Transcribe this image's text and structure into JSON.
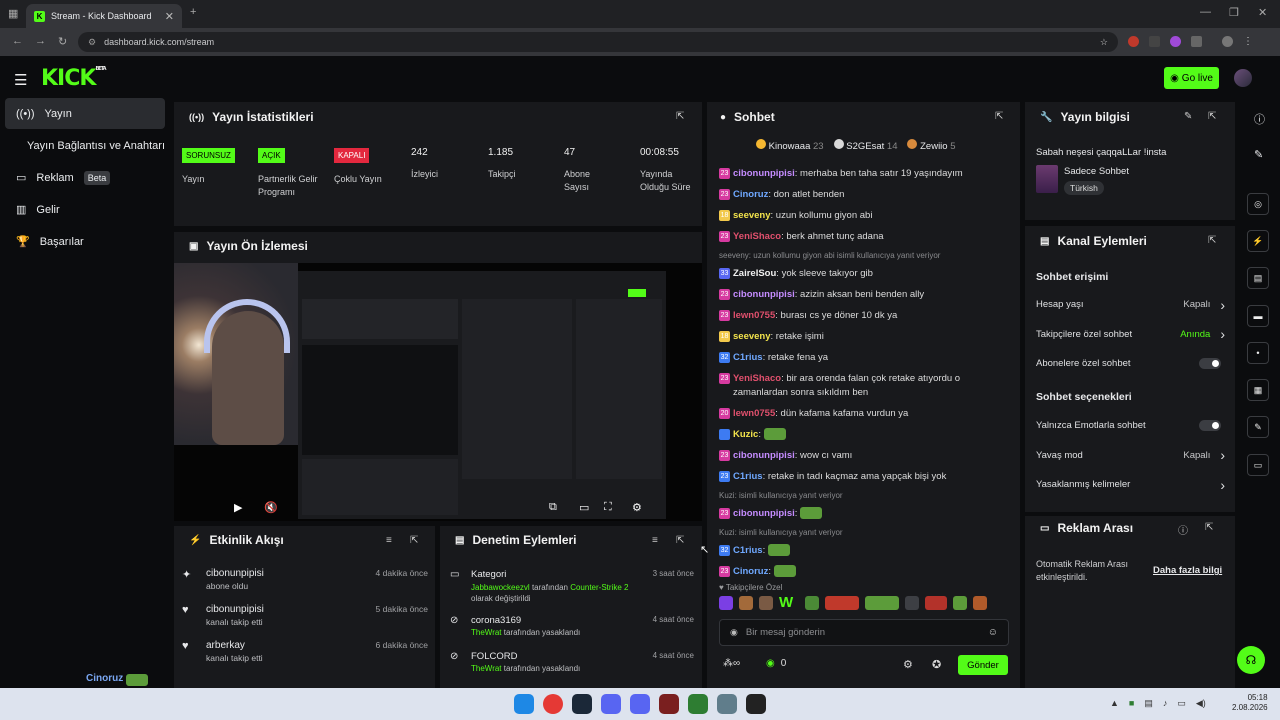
{
  "browser": {
    "tab_title": "Stream - Kick Dashboard",
    "url": "dashboard.kick.com/stream",
    "new_tab": "+"
  },
  "app": {
    "logo": "KICK",
    "logo_badge": "BETA",
    "go_live": "Go live",
    "accent": "#53fc18"
  },
  "nav": [
    {
      "label": "Yayın",
      "icon": "broadcast-icon"
    },
    {
      "label": "Yayın Bağlantısı ve Anahtarı"
    },
    {
      "label": "Reklam",
      "badge": "Beta",
      "icon": "ads-icon"
    },
    {
      "label": "Gelir",
      "icon": "chart-icon"
    },
    {
      "label": "Başarılar",
      "icon": "trophy-icon"
    }
  ],
  "stats": {
    "title": "Yayın İstatistikleri",
    "items": [
      {
        "badge": "SORUNSUZ",
        "label": "Yayın",
        "color": "#53fc18"
      },
      {
        "badge": "AÇIK",
        "label": "Partnerlik Gelir Programı",
        "color": "#53fc18"
      },
      {
        "badge": "KAPALI",
        "label": "Çoklu Yayın",
        "color": "#e3283e"
      },
      {
        "value": "242",
        "label": "İzleyici"
      },
      {
        "value": "1.185",
        "label": "Takipçi"
      },
      {
        "value": "47",
        "label": "Abone Sayısı"
      },
      {
        "value": "00:08:55",
        "label": "Yayında Olduğu Süre"
      }
    ]
  },
  "preview": {
    "title": "Yayın Ön İzlemesi"
  },
  "activity": {
    "title": "Etkinlik Akışı",
    "items": [
      {
        "user": "cibonunpipisi",
        "action": "abone oldu",
        "time": "4 dakika önce",
        "icon": "sparkle-icon"
      },
      {
        "user": "cibonunpipisi",
        "action": "kanalı takip etti",
        "time": "5 dakika önce",
        "icon": "heart-icon"
      },
      {
        "user": "arberkay",
        "action": "kanalı takip etti",
        "time": "6 dakika önce",
        "icon": "heart-icon"
      }
    ]
  },
  "moderation": {
    "title": "Denetim Eylemleri",
    "items": [
      {
        "title": "Kategori",
        "actor": "Jabbawockeezvl",
        "mid": "tarafından",
        "target": "Counter-Strike 2",
        "tail": "olarak değiştirildi",
        "time": "3 saat önce"
      },
      {
        "title": "corona3169",
        "actor": "TheWrat",
        "mid": "tarafından yasaklandı",
        "time": "4 saat önce"
      },
      {
        "title": "FOLCORD",
        "actor": "TheWrat",
        "mid": "tarafından yasaklandı",
        "time": "4 saat önce"
      }
    ]
  },
  "chat": {
    "title": "Sohbet",
    "top": [
      {
        "name": "Kinowaaa",
        "count": "23",
        "color": "#f5b731"
      },
      {
        "name": "S2GEsat",
        "count": "14",
        "color": "#d9d9d9"
      },
      {
        "name": "Zewiio",
        "count": "5",
        "color": "#d88a3c"
      }
    ],
    "messages": [
      {
        "badge": "23",
        "bc": "#d63aa0",
        "user": "cibonunpipisi",
        "uc": "#c58cff",
        "text": "merhaba ben taha satır 19 yaşındayım"
      },
      {
        "badge": "23",
        "bc": "#d63aa0",
        "user": "Cinoruz",
        "uc": "#6fa8ff",
        "text": "don atlet benden"
      },
      {
        "badge": "18",
        "bc": "#f2c94c",
        "user": "seeveny",
        "uc": "#f2e34c",
        "text": "uzun kollumu giyon abi"
      },
      {
        "badge": "23",
        "bc": "#d63aa0",
        "user": "YeniShaco",
        "uc": "#e0506d",
        "text": "berk ahmet tunç adana"
      },
      {
        "reply": "seeveny: uzun kollumu giyon abi isimli kullanıcıya yanıt veriyor"
      },
      {
        "badge": "33",
        "bc": "#5867f2",
        "user": "ZaireISou",
        "uc": "#f0f0f0",
        "text": "yok sleeve takıyor gib"
      },
      {
        "badge": "23",
        "bc": "#d63aa0",
        "user": "cibonunpipisi",
        "uc": "#c58cff",
        "text": "azizin aksan beni benden ally"
      },
      {
        "badge": "23",
        "bc": "#d63aa0",
        "user": "lewn0755",
        "uc": "#e0506d",
        "text": "burası cs ye döner 10 dk ya"
      },
      {
        "badge": "18",
        "bc": "#f2c94c",
        "user": "seeveny",
        "uc": "#f2e34c",
        "text": "retake işimi"
      },
      {
        "badge": "32",
        "bc": "#3d7bf2",
        "user": "C1rius",
        "uc": "#6fa8ff",
        "text": "retake fena ya"
      },
      {
        "badge": "23",
        "bc": "#d63aa0",
        "user": "YeniShaco",
        "uc": "#e0506d",
        "text": "bir ara orenda falan çok retake atıyordu o zamanlardan sonra sıkıldım ben"
      },
      {
        "badge": "20",
        "bc": "#d63aa0",
        "user": "lewn0755",
        "uc": "#e0506d",
        "text": "dün kafama kafama vurdun ya"
      },
      {
        "badge": "",
        "bc": "#3d7bf2",
        "user": "Kuzic",
        "uc": "#f2e34c",
        "text": ""
      },
      {
        "badge": "23",
        "bc": "#d63aa0",
        "user": "cibonunpipisi",
        "uc": "#c58cff",
        "text": "wow cı vamı"
      },
      {
        "badge": "23",
        "bc": "#3d7bf2",
        "user": "C1rius",
        "uc": "#6fa8ff",
        "text": "retake in tadı kaçmaz ama yapçak bişi yok"
      },
      {
        "reply": "Kuzi: isimli kullanıcıya yanıt veriyor"
      },
      {
        "badge": "23",
        "bc": "#d63aa0",
        "user": "cibonunpipisi",
        "uc": "#c58cff",
        "text": ""
      },
      {
        "reply": "Kuzi: isimli kullanıcıya yanıt veriyor"
      },
      {
        "badge": "32",
        "bc": "#3d7bf2",
        "user": "C1rius",
        "uc": "#6fa8ff",
        "text": ""
      },
      {
        "badge": "23",
        "bc": "#d63aa0",
        "user": "Cinoruz",
        "uc": "#6fa8ff",
        "text": ""
      }
    ],
    "followers_only": "Takipçilere Özel",
    "placeholder": "Bir mesaj gönderin",
    "count": "0",
    "send": "Gönder"
  },
  "stream_info": {
    "title": "Yayın bilgisi",
    "stream_title": "Sabah neşesi çaqqaLLar !insta",
    "category": "Sadece Sohbet",
    "language": "Türkish"
  },
  "channel": {
    "title": "Kanal Eylemleri",
    "chat_access": "Sohbet erişimi",
    "rows1": [
      {
        "label": "Hesap yaşı",
        "value": "Kapalı",
        "vc": "#c8c9cb",
        "type": "chev"
      },
      {
        "label": "Takipçilere özel sohbet",
        "value": "Anında",
        "vc": "#53fc18",
        "type": "chev"
      },
      {
        "label": "Abonelere özel sohbet",
        "type": "toggle"
      }
    ],
    "chat_options": "Sohbet seçenekleri",
    "rows2": [
      {
        "label": "Yalnızca Emotlarla sohbet",
        "type": "toggle"
      },
      {
        "label": "Yavaş mod",
        "value": "Kapalı",
        "vc": "#c8c9cb",
        "type": "chev"
      },
      {
        "label": "Yasaklanmış kelimeler",
        "type": "chev"
      }
    ]
  },
  "adbreak": {
    "title": "Reklam Arası",
    "desc": "Otomatik Reklam Arası etkinleştirildi.",
    "link": "Daha fazla bilgi"
  },
  "overlay_name": "Cinoruz",
  "taskbar": {
    "time": "05:18",
    "date": "2.08.2026"
  }
}
